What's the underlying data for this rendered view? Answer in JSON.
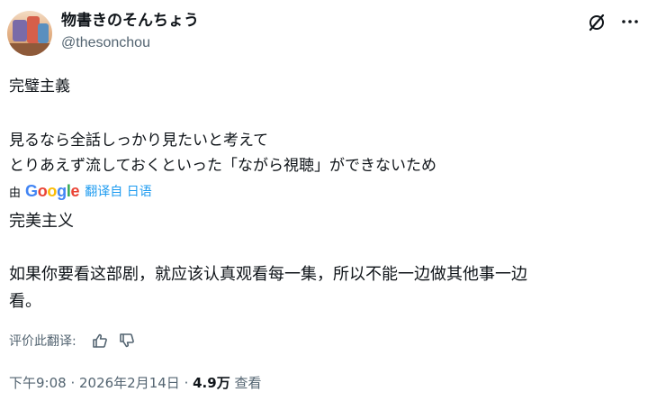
{
  "author": {
    "display_name": "物書きのそんちょう",
    "handle": "@thesonchou"
  },
  "header_icons": {
    "grok": "grok-icon",
    "more": "more-icon"
  },
  "post": {
    "original_lines": [
      "完璧主義",
      "見るなら全話しっかり見たいと考えて",
      "とりあえず流しておくといった「ながら視聴」ができないため"
    ],
    "translation_attribution": {
      "by": "由",
      "provider_letters": [
        "G",
        "o",
        "o",
        "g",
        "l",
        "e"
      ],
      "from_label": "翻译自 日语"
    },
    "translated_lines": [
      "完美主义",
      "如果你要看这部剧，就应该认真观看每一集，所以不能一边做其他事一边",
      "看。"
    ],
    "rate_translation": {
      "label": "评价此翻译:",
      "thumbs_up": "thumbs-up-icon",
      "thumbs_down": "thumbs-down-icon"
    }
  },
  "meta": {
    "time": "下午9:08",
    "separator1": " · ",
    "date": "2026年2月14日",
    "separator2": " · ",
    "views_count": "4.9万",
    "views_label": " 查看"
  },
  "colors": {
    "text": "#0f1419",
    "secondary": "#536471",
    "link": "#1d9bf0"
  }
}
